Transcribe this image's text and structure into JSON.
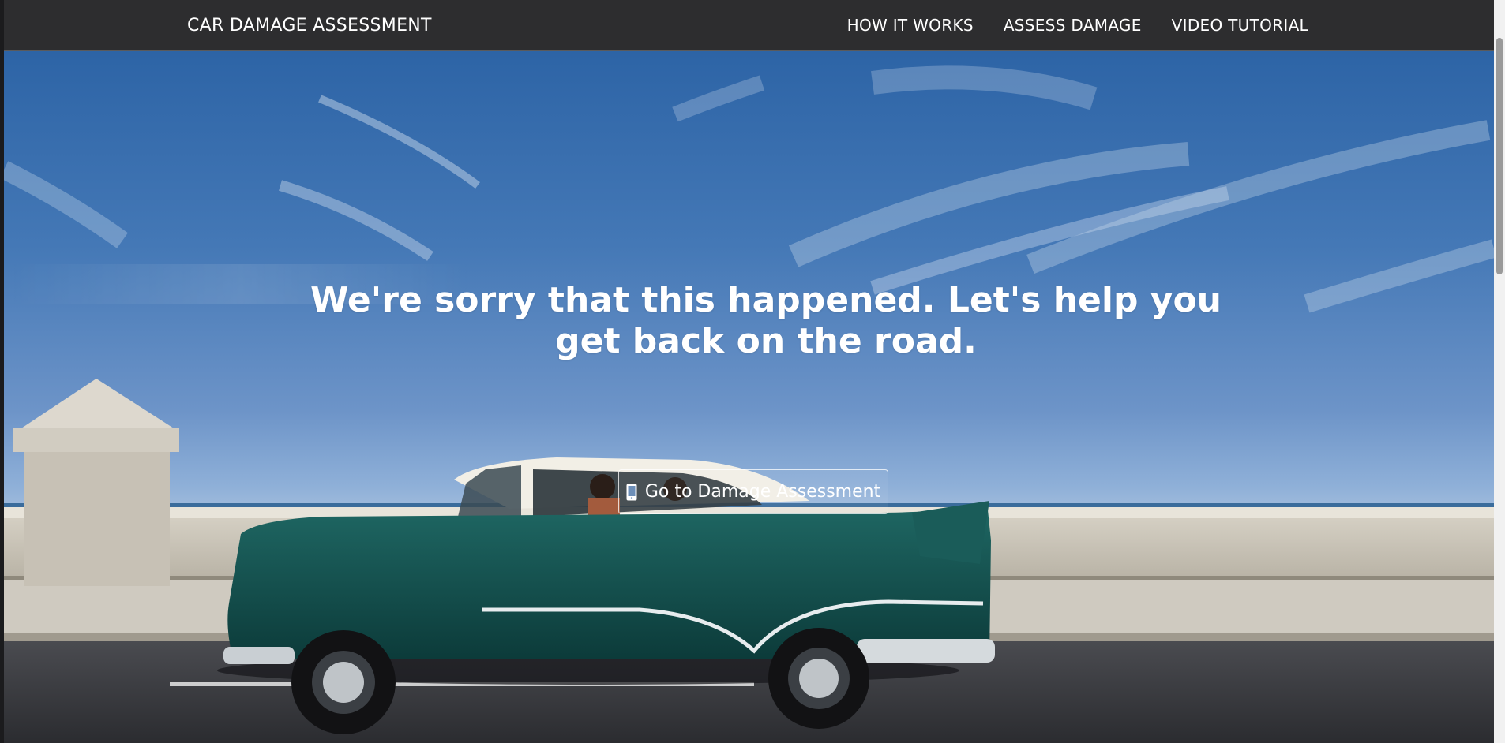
{
  "navbar": {
    "brand": "CAR DAMAGE ASSESSMENT",
    "links": [
      {
        "label": "HOW IT WORKS"
      },
      {
        "label": "ASSESS DAMAGE"
      },
      {
        "label": "VIDEO TUTORIAL"
      }
    ]
  },
  "hero": {
    "headline": "We're sorry that this happened. Let's help you get back on the road.",
    "cta_label": "Go to Damage Assessment",
    "cta_icon": "mobile-phone-icon"
  },
  "colors": {
    "navbar_bg": "#2d2d2f",
    "sky": "#4478b6",
    "car_body": "#15514f",
    "car_roof": "#f2efe6"
  }
}
